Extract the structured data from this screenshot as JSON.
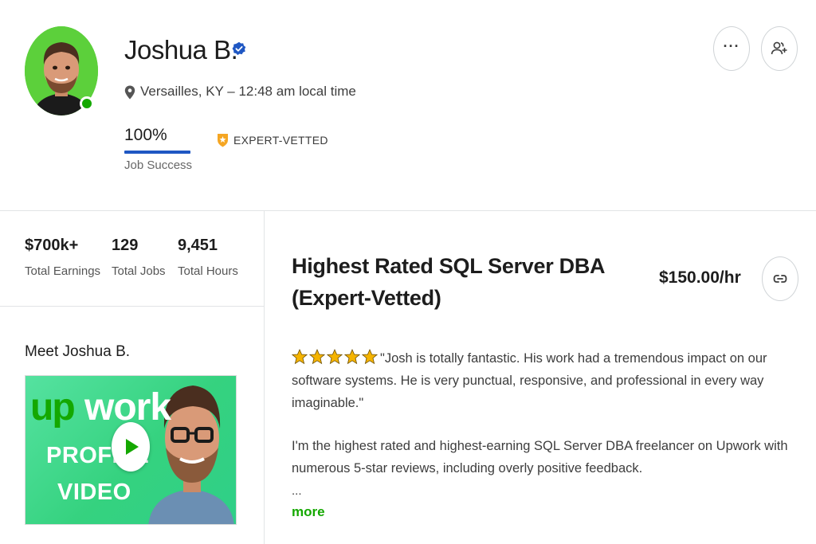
{
  "profile": {
    "name": "Joshua B.",
    "location": "Versailles, KY – 12:48 am local time",
    "job_success_value": "100%",
    "job_success_label": "Job Success",
    "job_success_fraction": 1.0,
    "badge_label": "EXPERT-VETTED",
    "online": true
  },
  "stats": [
    {
      "value": "$700k+",
      "label": "Total Earnings"
    },
    {
      "value": "129",
      "label": "Total Jobs"
    },
    {
      "value": "9,451",
      "label": "Total Hours"
    }
  ],
  "video": {
    "heading": "Meet Joshua B.",
    "thumb_up": "up",
    "thumb_work": "work",
    "thumb_line1": "PROFILE",
    "thumb_line2": "VIDEO"
  },
  "listing": {
    "title": "Highest Rated SQL Server DBA (Expert-Vetted)",
    "rate": "$150.00/hr",
    "rating_stars": 5,
    "review": "\"Josh is totally fantastic. His work had a tremendous impact on our software systems. He is very punctual, responsive, and professional in every way imaginable.\"",
    "description": "I'm the highest rated and highest-earning SQL Server DBA freelancer on Upwork with numerous 5-star reviews, including overly positive feedback.",
    "ellipsis": "...",
    "more_label": "more"
  },
  "icons": {
    "more": "more-horizontal-icon",
    "add_user": "add-user-icon",
    "link": "link-icon",
    "verified": "verified-badge-icon",
    "location": "location-pin-icon",
    "expert": "expert-vetted-shield-icon",
    "play": "play-icon",
    "star": "star-icon"
  },
  "colors": {
    "brand_green": "#14a800",
    "verified_blue": "#1f57c3",
    "star_gold": "#f5b400"
  }
}
